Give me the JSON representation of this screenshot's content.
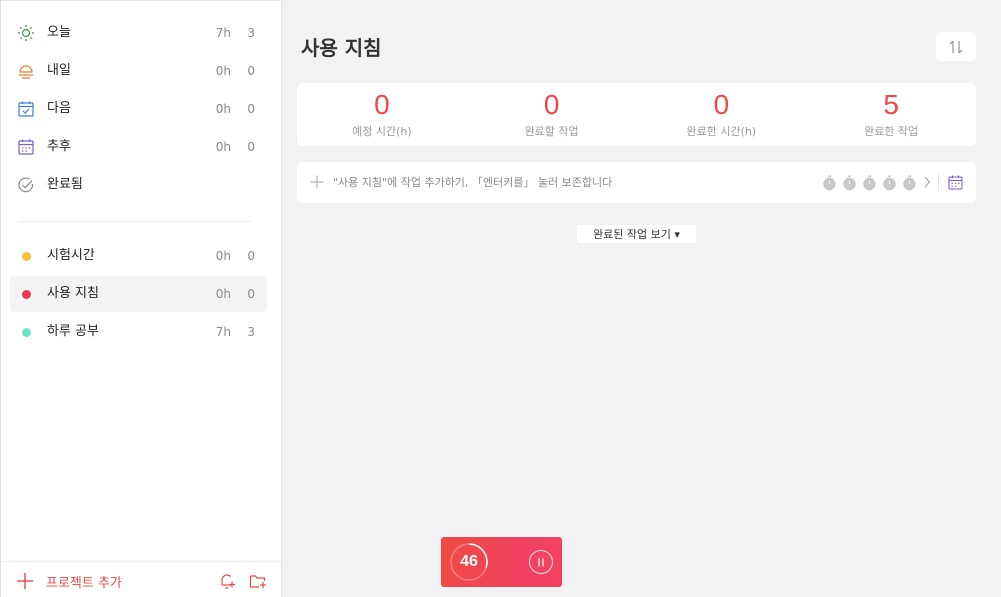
{
  "sidebar": {
    "smart_lists": [
      {
        "label": "오늘",
        "time": "7h",
        "count": "3",
        "icon": "sun-icon",
        "color": "#2e9e3e"
      },
      {
        "label": "내일",
        "time": "0h",
        "count": "0",
        "icon": "sunset-icon",
        "color": "#f07a2c"
      },
      {
        "label": "다음",
        "time": "0h",
        "count": "0",
        "icon": "calendar-check-icon",
        "color": "#3a7fd6"
      },
      {
        "label": "추후",
        "time": "0h",
        "count": "0",
        "icon": "calendar-icon",
        "color": "#7b5fc9"
      },
      {
        "label": "완료됨",
        "icon": "check-circle-icon",
        "color": "#888888"
      }
    ],
    "projects": [
      {
        "label": "시험시간",
        "time": "0h",
        "count": "0",
        "color": "#f6c23a"
      },
      {
        "label": "사용 지침",
        "time": "0h",
        "count": "0",
        "color": "#e8384f",
        "selected": true
      },
      {
        "label": "하루 공부",
        "time": "7h",
        "count": "3",
        "color": "#6fe3c8"
      }
    ],
    "add_project_label": "프로젝트 추가"
  },
  "main": {
    "title": "사용 지침",
    "stats": [
      {
        "value": "0",
        "label": "예정 시간(h)"
      },
      {
        "value": "0",
        "label": "완료할 작업"
      },
      {
        "value": "0",
        "label": "완료한 시간(h)"
      },
      {
        "value": "5",
        "label": "완료한 작업"
      }
    ],
    "add_task_placeholder": "\"사용 지침\"에 작업 추가하기, 「엔터키를」 눌러 보존합니다",
    "show_completed_label": "완료된 작업 보기 ▾"
  },
  "timer": {
    "value": "46",
    "progress": 0.3
  },
  "colors": {
    "accent": "#f0484a"
  }
}
